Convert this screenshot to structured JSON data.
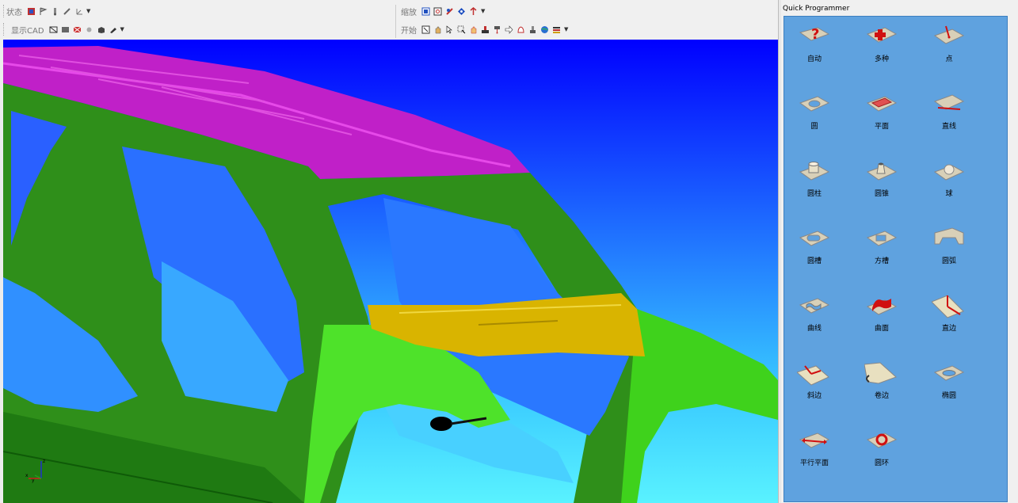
{
  "toolbar": {
    "row1_left_label": "状态",
    "row2_left_label": "显示CAD",
    "row1_right_label": "缩放",
    "row2_right_label": "开始"
  },
  "panel": {
    "title": "Quick Programmer",
    "items": [
      {
        "label": "自动",
        "icon": "question-icon"
      },
      {
        "label": "多种",
        "icon": "plus-icon"
      },
      {
        "label": "点",
        "icon": "point-icon"
      },
      {
        "label": "圆",
        "icon": "circle-icon"
      },
      {
        "label": "平面",
        "icon": "plane-icon"
      },
      {
        "label": "直线",
        "icon": "line-icon"
      },
      {
        "label": "圆柱",
        "icon": "cylinder-icon"
      },
      {
        "label": "圆锥",
        "icon": "cone-icon"
      },
      {
        "label": "球",
        "icon": "sphere-icon"
      },
      {
        "label": "圆槽",
        "icon": "round-slot-icon"
      },
      {
        "label": "方槽",
        "icon": "square-slot-icon"
      },
      {
        "label": "圆弧",
        "icon": "arc-icon"
      },
      {
        "label": "曲线",
        "icon": "curve-icon"
      },
      {
        "label": "曲面",
        "icon": "surface-icon"
      },
      {
        "label": "直边",
        "icon": "edge-icon"
      },
      {
        "label": "斜边",
        "icon": "bevel-edge-icon"
      },
      {
        "label": "卷边",
        "icon": "hem-edge-icon"
      },
      {
        "label": "椭圆",
        "icon": "ellipse-icon"
      },
      {
        "label": "平行平面",
        "icon": "parallel-planes-icon"
      },
      {
        "label": "圆环",
        "icon": "torus-icon"
      }
    ]
  },
  "viewport": {
    "axis_labels": {
      "z": "z",
      "x": "x",
      "y": "y"
    }
  },
  "colors": {
    "panel_bg": "#5fa2df",
    "roof": "#d633d6",
    "body": "#2f8f1a",
    "fender": "#3fd21c",
    "crossbar": "#d9b400"
  }
}
